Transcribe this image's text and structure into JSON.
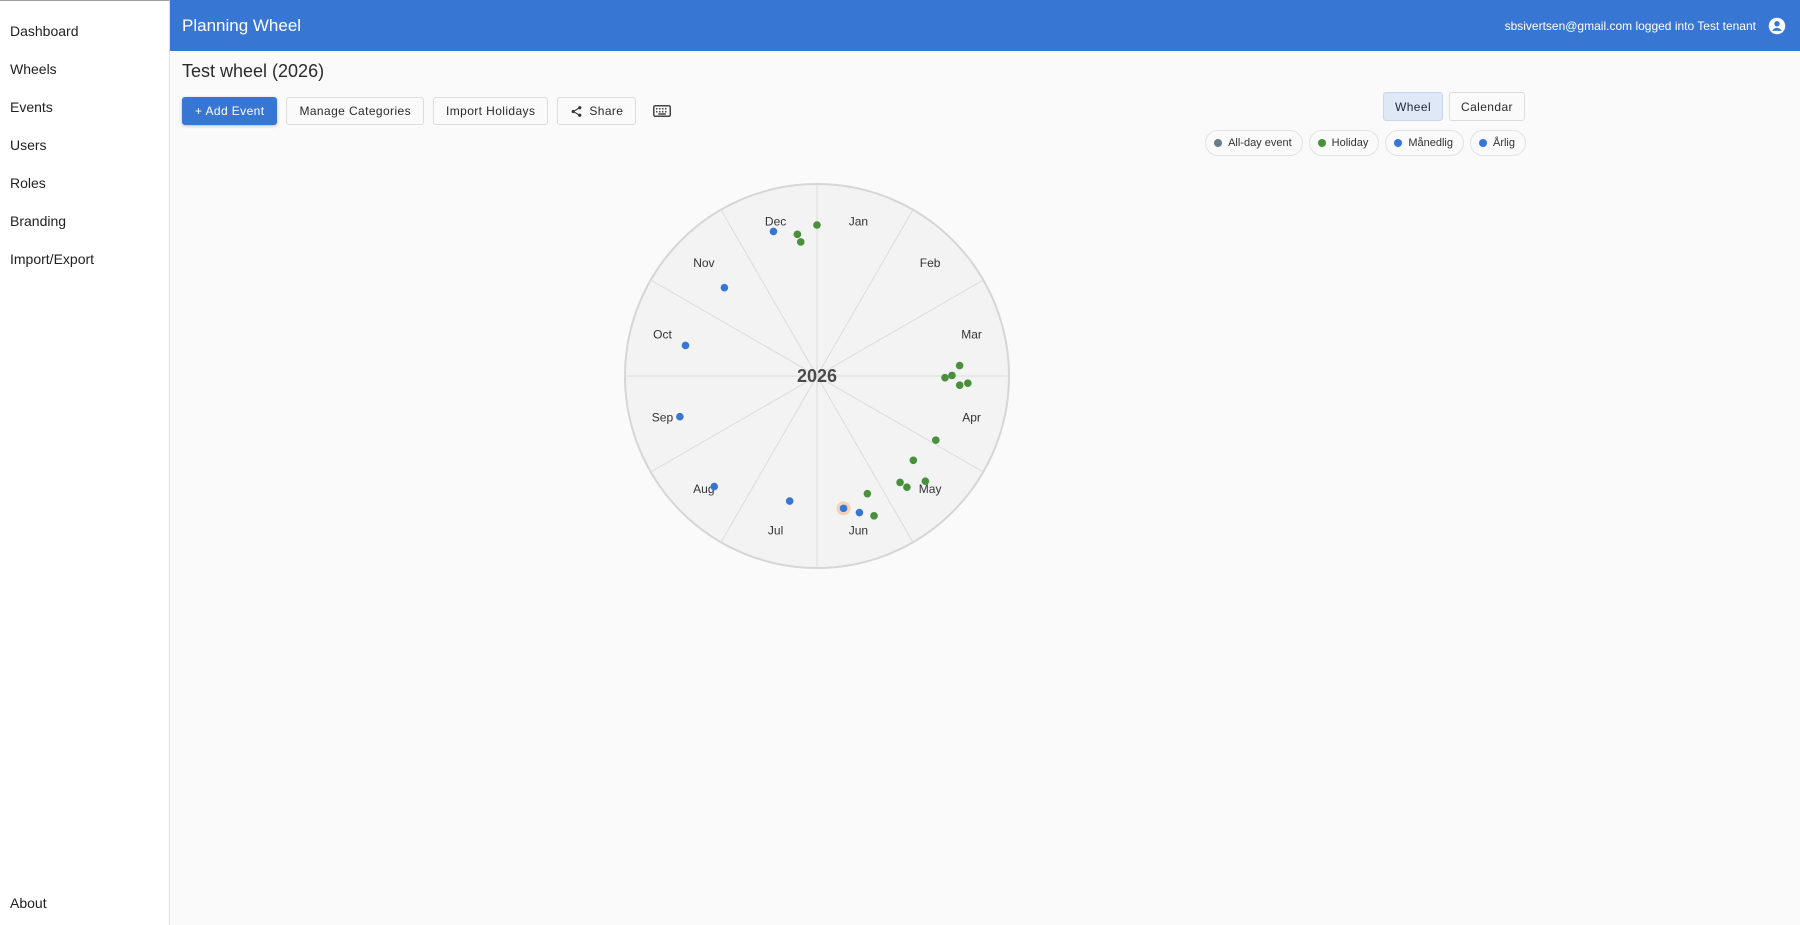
{
  "sidebar": {
    "items": [
      {
        "label": "Dashboard"
      },
      {
        "label": "Wheels"
      },
      {
        "label": "Events"
      },
      {
        "label": "Users"
      },
      {
        "label": "Roles"
      },
      {
        "label": "Branding"
      },
      {
        "label": "Import/Export"
      }
    ],
    "about": "About"
  },
  "appbar": {
    "title": "Planning Wheel",
    "user_text": "sbsivertsen@gmail.com logged into Test tenant",
    "account_icon": "account-circle-icon"
  },
  "page": {
    "title": "Test wheel (2026)"
  },
  "toolbar": {
    "add_event": "+ Add Event",
    "manage_categories": "Manage Categories",
    "import_holidays": "Import Holidays",
    "share": "Share",
    "share_icon": "share-icon",
    "keyboard_icon": "keyboard-icon"
  },
  "view": {
    "wheel": "Wheel",
    "calendar": "Calendar",
    "active": "Wheel"
  },
  "legend": [
    {
      "label": "All-day event",
      "color": "#6b7a8a"
    },
    {
      "label": "Holiday",
      "color": "#4a8f3c"
    },
    {
      "label": "Månedlig",
      "color": "#3876d3"
    },
    {
      "label": "Årlig",
      "color": "#3876d3"
    }
  ],
  "wheel": {
    "year": "2026",
    "months": [
      "Jan",
      "Feb",
      "Mar",
      "Apr",
      "May",
      "Jun",
      "Jul",
      "Aug",
      "Sep",
      "Oct",
      "Nov",
      "Dec"
    ],
    "colors": {
      "holiday": "#4a8f3c",
      "recurring": "#3876d3",
      "highlight": "#f5c9a8",
      "ring": "#d6d6d6",
      "fill": "#f3f3f3"
    },
    "events": [
      {
        "month": 1,
        "day": 1,
        "category": "holiday"
      },
      {
        "month": 3,
        "day": 29,
        "category": "holiday"
      },
      {
        "month": 4,
        "day": 2,
        "category": "holiday"
      },
      {
        "month": 4,
        "day": 3,
        "category": "holiday"
      },
      {
        "month": 4,
        "day": 5,
        "category": "holiday"
      },
      {
        "month": 4,
        "day": 6,
        "category": "holiday"
      },
      {
        "month": 5,
        "day": 1,
        "category": "holiday"
      },
      {
        "month": 5,
        "day": 14,
        "category": "holiday"
      },
      {
        "month": 5,
        "day": 17,
        "category": "holiday"
      },
      {
        "month": 5,
        "day": 24,
        "category": "holiday"
      },
      {
        "month": 5,
        "day": 25,
        "category": "holiday"
      },
      {
        "month": 6,
        "day": 9,
        "category": "holiday"
      },
      {
        "month": 6,
        "day": 10,
        "category": "holiday"
      },
      {
        "month": 6,
        "day": 15,
        "category": "recurring"
      },
      {
        "month": 6,
        "day": 21,
        "category": "recurring",
        "highlight": true
      },
      {
        "month": 7,
        "day": 15,
        "category": "recurring"
      },
      {
        "month": 8,
        "day": 15,
        "category": "recurring"
      },
      {
        "month": 9,
        "day": 15,
        "category": "recurring"
      },
      {
        "month": 10,
        "day": 15,
        "category": "recurring"
      },
      {
        "month": 11,
        "day": 15,
        "category": "recurring"
      },
      {
        "month": 12,
        "day": 15,
        "category": "recurring"
      },
      {
        "month": 12,
        "day": 24,
        "category": "holiday"
      },
      {
        "month": 12,
        "day": 25,
        "category": "holiday"
      }
    ]
  }
}
